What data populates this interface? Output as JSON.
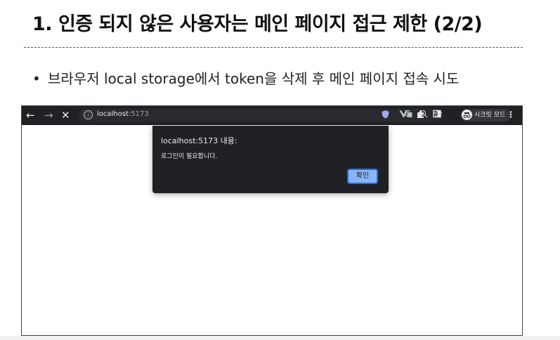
{
  "slide": {
    "title": "1. 인증 되지 않은 사용자는 메인 페이지 접근 제한 (2/2)",
    "bullet_marker": "•",
    "bullet_text": "브라우저 local storage에서 token을 삭제 후 메인 페이지 접속 시도"
  },
  "browser": {
    "nav": {
      "back": "←",
      "forward": "→",
      "stop": "✕"
    },
    "address_bar": {
      "info_icon": "ⓘ",
      "host": "localhost",
      "port": ":5173"
    },
    "toolbar_icons": [
      "translate-icon",
      "zoom-icon",
      "star-icon",
      "shield-extension-icon",
      "vue-extension-icon",
      "puzzle-extensions-icon",
      "side-panel-icon"
    ],
    "incognito_label": "시크릿 모드",
    "menu_icon": "⋮",
    "dialog": {
      "title": "localhost:5173 내용:",
      "message": "로그인이 필요합니다.",
      "ok_label": "확인"
    }
  },
  "colors": {
    "toolbar_bg": "#202124",
    "dialog_bg": "#202124",
    "button_bg": "#8ab4f8",
    "button_border": "#1a73e8"
  }
}
